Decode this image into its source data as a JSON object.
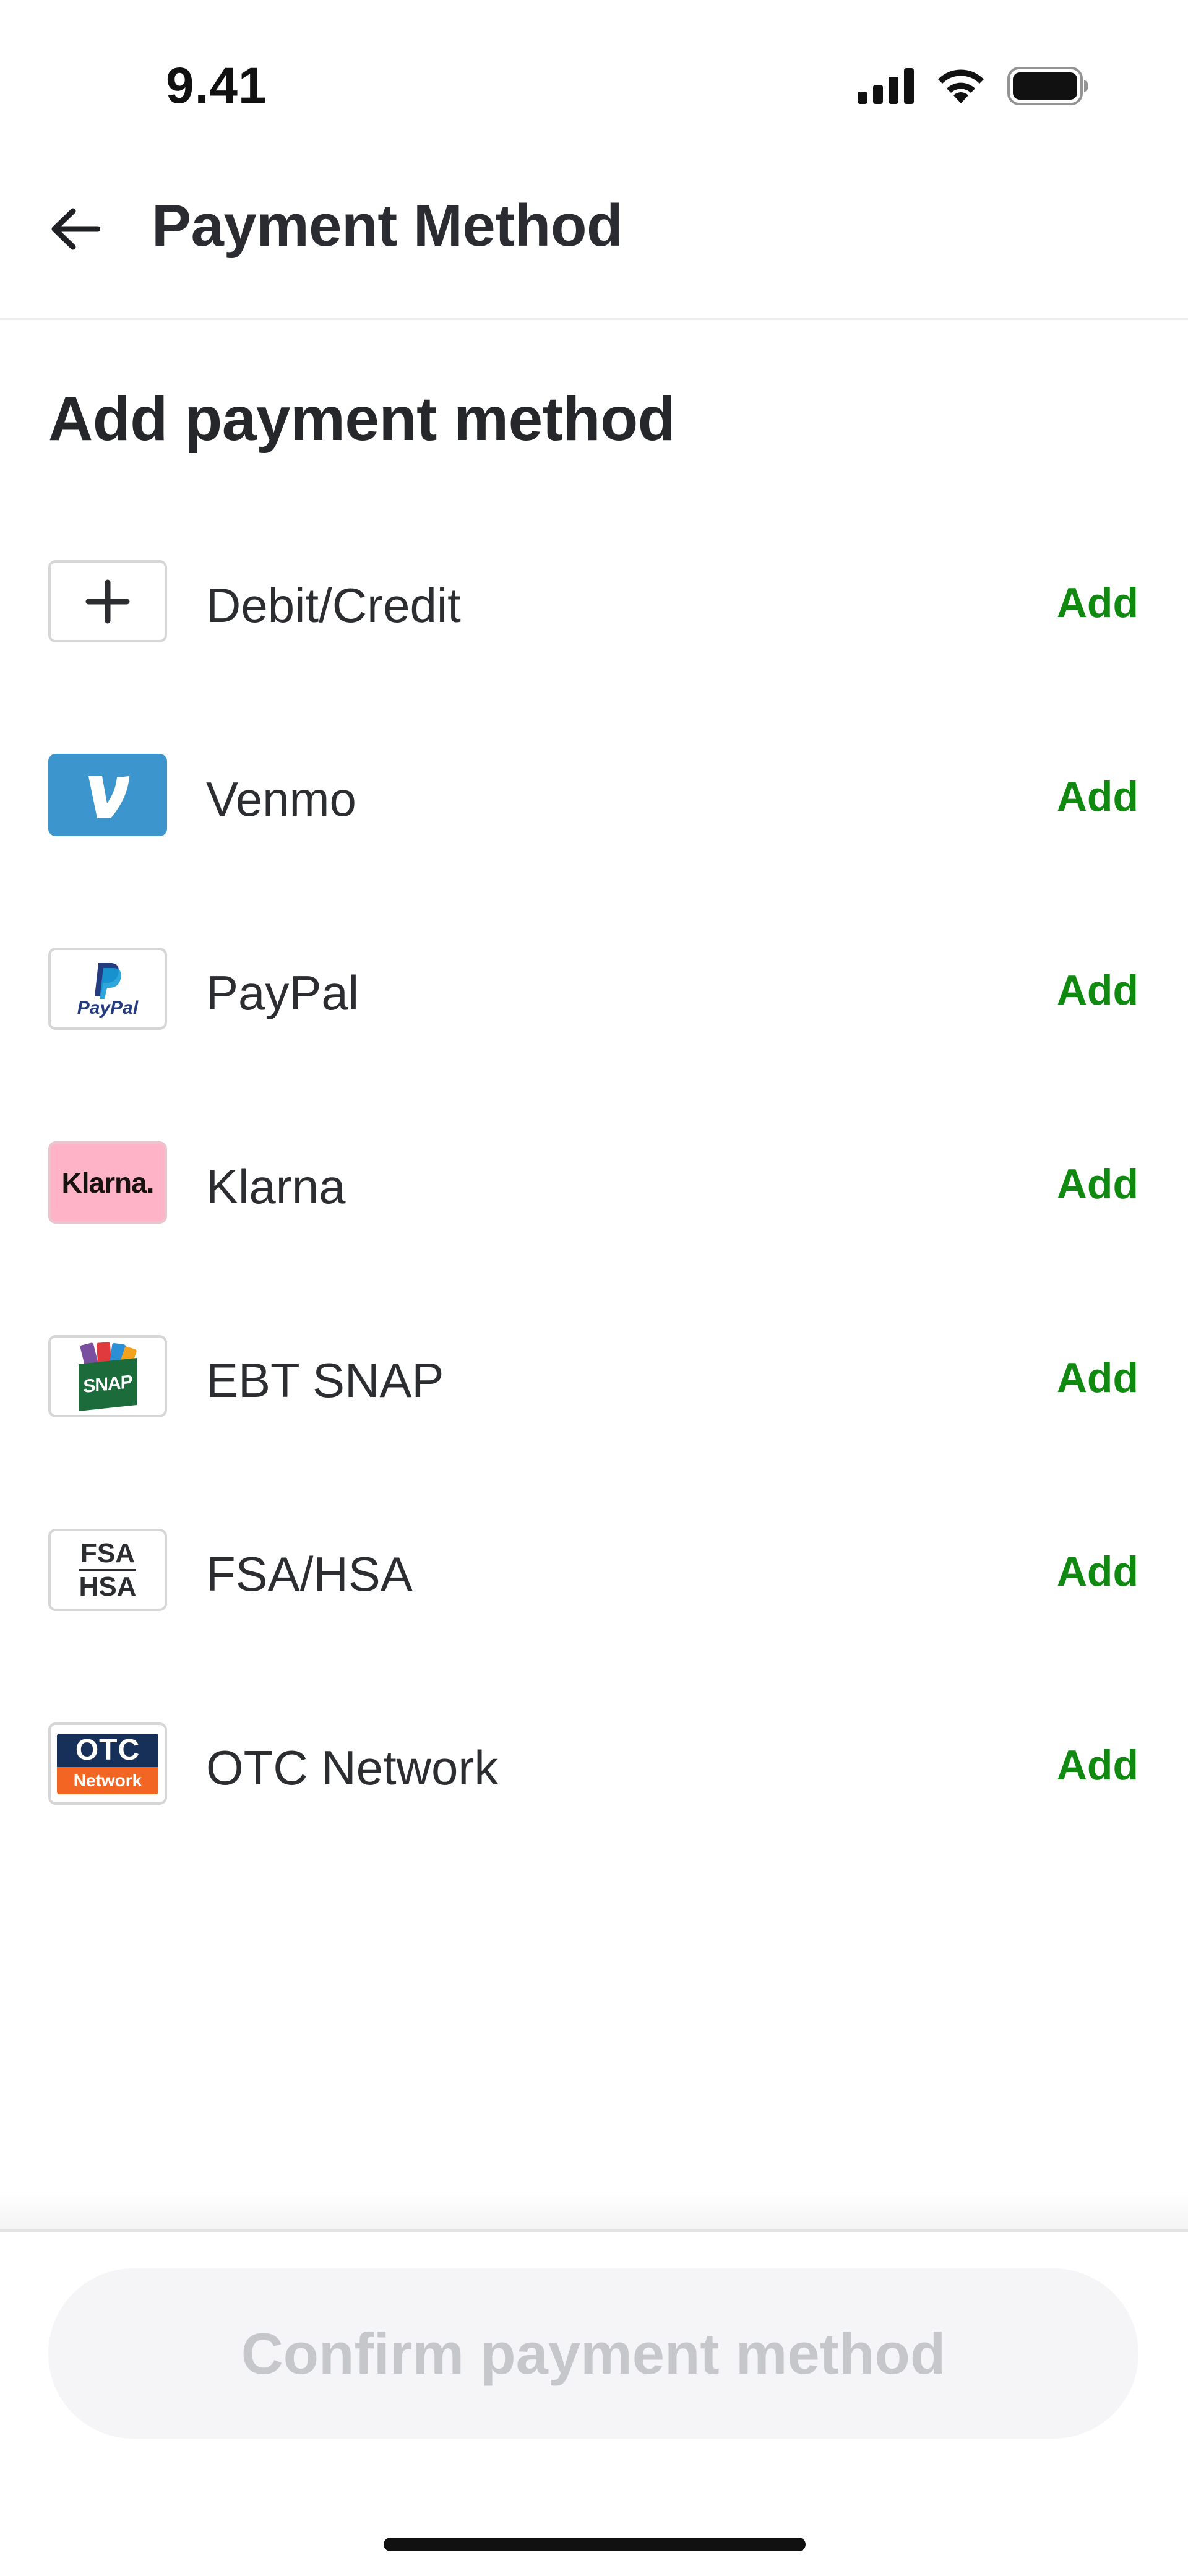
{
  "status_bar": {
    "time": "9.41",
    "icons": [
      "cellular-signal-icon",
      "wifi-icon",
      "battery-icon"
    ]
  },
  "header": {
    "title": "Payment Method",
    "back_icon": "arrow-left-icon"
  },
  "section_title": "Add payment method",
  "methods": [
    {
      "label": "Debit/Credit",
      "action": "Add",
      "icon": "plus-icon"
    },
    {
      "label": "Venmo",
      "action": "Add",
      "icon": "venmo-logo"
    },
    {
      "label": "PayPal",
      "action": "Add",
      "icon": "paypal-logo",
      "logo_text": "PayPal"
    },
    {
      "label": "Klarna",
      "action": "Add",
      "icon": "klarna-logo",
      "logo_text": "Klarna."
    },
    {
      "label": "EBT SNAP",
      "action": "Add",
      "icon": "snap-logo",
      "logo_text": "SNAP"
    },
    {
      "label": "FSA/HSA",
      "action": "Add",
      "icon": "fsa-hsa-logo",
      "logo_text_top": "FSA",
      "logo_text_bottom": "HSA"
    },
    {
      "label": "OTC Network",
      "action": "Add",
      "icon": "otc-network-logo",
      "logo_text_top": "OTC",
      "logo_text_bottom": "Network"
    }
  ],
  "confirm_button": {
    "label": "Confirm payment method",
    "enabled": false
  },
  "colors": {
    "accent_green": "#108910",
    "venmo_blue": "#3d95ce",
    "klarna_pink": "#ffb3c7",
    "snap_green": "#1c6b3a",
    "otc_navy": "#17305a",
    "otc_orange": "#f26522",
    "disabled_text": "#c6c7cb"
  }
}
